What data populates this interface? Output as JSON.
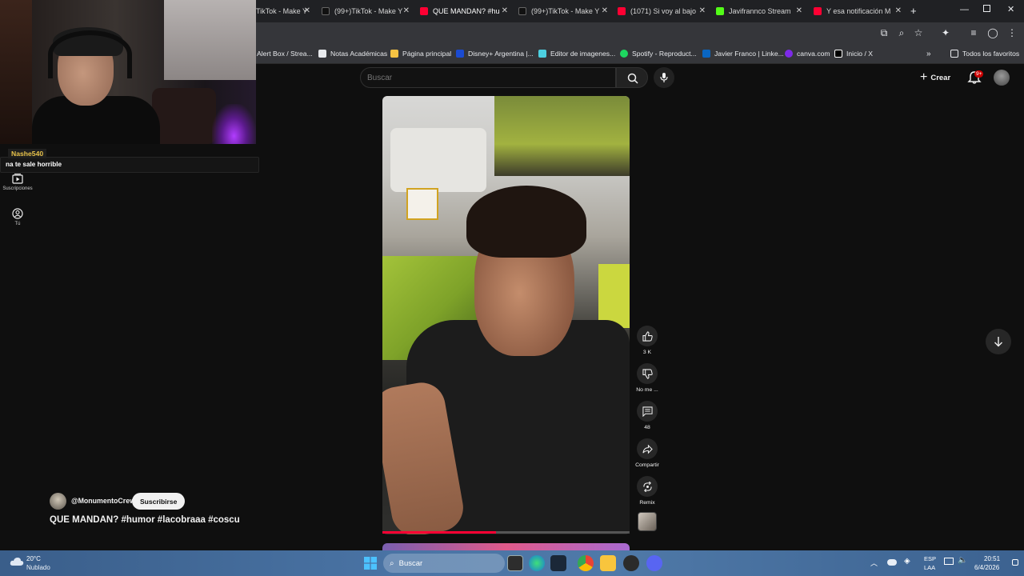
{
  "browser": {
    "tabs": [
      {
        "title": "TikTok - Make Y",
        "favicon": "tiktok-icon",
        "color": "#111111"
      },
      {
        "title": "(99+)TikTok - Make Y",
        "favicon": "tiktok-icon",
        "color": "#111111"
      },
      {
        "title": "QUE MANDAN? #hu",
        "favicon": "youtube-icon",
        "color": "#ff0033",
        "active": true
      },
      {
        "title": "(99+)TikTok - Make Y",
        "favicon": "tiktok-icon",
        "color": "#111111"
      },
      {
        "title": "(1071) Si voy al bajo",
        "favicon": "youtube-icon",
        "color": "#ff0033"
      },
      {
        "title": "Javifrannco Stream",
        "favicon": "kick-icon",
        "color": "#53fc18"
      },
      {
        "title": "Y esa notificación M",
        "favicon": "youtube-icon",
        "color": "#ff0033"
      }
    ],
    "bookmarks": [
      {
        "label": "Alert Box / Strea...",
        "favicon": "streamlabs-icon",
        "color": "#80f5d2"
      },
      {
        "label": "Notas Académicas",
        "favicon": "document-icon",
        "color": "#e8eaed"
      },
      {
        "label": "Página principal",
        "favicon": "image-icon",
        "color": "#f6c343"
      },
      {
        "label": "Disney+ Argentina |...",
        "favicon": "disney-icon",
        "color": "#1b4bd1"
      },
      {
        "label": "Editor de imagenes...",
        "favicon": "editor-icon",
        "color": "#4dd0e1"
      },
      {
        "label": "Spotify - Reproduct...",
        "favicon": "spotify-icon",
        "color": "#1ed760"
      },
      {
        "label": "Javier Franco | Linke...",
        "favicon": "linkedin-icon",
        "color": "#0a66c2"
      },
      {
        "label": "canva.com",
        "favicon": "canva-icon",
        "color": "#7d2ae8"
      },
      {
        "label": "Inicio / X",
        "favicon": "x-icon",
        "color": "#ffffff"
      }
    ],
    "all_bookmarks": "Todos los favoritos"
  },
  "youtube": {
    "search_placeholder": "Buscar",
    "create_label": "Crear",
    "notifications_badge": "9+",
    "guide": [
      {
        "label": "Suscripciones",
        "icon": "subscriptions-icon"
      },
      {
        "label": "Tú",
        "icon": "you-icon"
      }
    ],
    "video": {
      "progress_fraction": 0.46,
      "channel": "@MonumentoCrew",
      "subscribe_label": "Suscribirse",
      "title": "QUE MANDAN? #humor #lacobraaa #coscu"
    },
    "actions": [
      {
        "icon": "thumbs-up-icon",
        "label": "3 K"
      },
      {
        "icon": "thumbs-down-icon",
        "label": "No me ..."
      },
      {
        "icon": "comment-icon",
        "label": "48"
      },
      {
        "icon": "share-icon",
        "label": "Compartir"
      },
      {
        "icon": "remix-icon",
        "label": "Remix"
      }
    ]
  },
  "stream_overlay": {
    "chat_user": "Nashe540",
    "chat_message": "na te sale horrible"
  },
  "taskbar": {
    "weather_temp": "20°C",
    "weather_desc": "Nublado",
    "search_label": "Buscar",
    "lang_1": "ESP",
    "lang_2": "LAA",
    "time": "20:51",
    "date": "6/4/2026"
  },
  "colors": {
    "accent": "#ff0033",
    "background": "#0f0f0f"
  }
}
